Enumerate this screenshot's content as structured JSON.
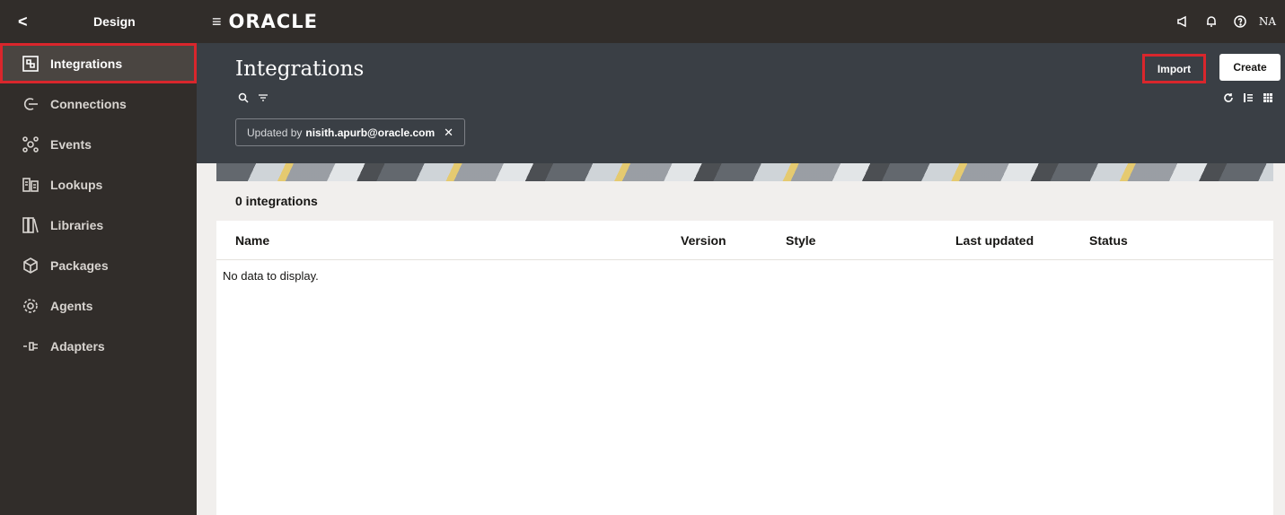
{
  "sidebar": {
    "back_label": "<",
    "title": "Design",
    "items": [
      {
        "label": "Integrations",
        "icon": "integrations-icon"
      },
      {
        "label": "Connections",
        "icon": "connections-icon"
      },
      {
        "label": "Events",
        "icon": "events-icon"
      },
      {
        "label": "Lookups",
        "icon": "lookups-icon"
      },
      {
        "label": "Libraries",
        "icon": "libraries-icon"
      },
      {
        "label": "Packages",
        "icon": "packages-icon"
      },
      {
        "label": "Agents",
        "icon": "agents-icon"
      },
      {
        "label": "Adapters",
        "icon": "adapters-icon"
      }
    ]
  },
  "topbar": {
    "menu_glyph": "≡",
    "brand": "ORACLE",
    "avatar_initials": "NA"
  },
  "header": {
    "title": "Integrations",
    "import_label": "Import",
    "create_label": "Create",
    "filter_chip": {
      "prefix": "Updated by",
      "value": "nisith.apurb@oracle.com",
      "remove_glyph": "✕"
    }
  },
  "table": {
    "count_label": "0 integrations",
    "columns": [
      "Name",
      "Version",
      "Style",
      "Last updated",
      "Status"
    ],
    "empty_message": "No data to display."
  },
  "colors": {
    "sidebar_bg": "#312d2a",
    "header_bg": "#3a3f45",
    "highlight_red": "#d9262c"
  }
}
